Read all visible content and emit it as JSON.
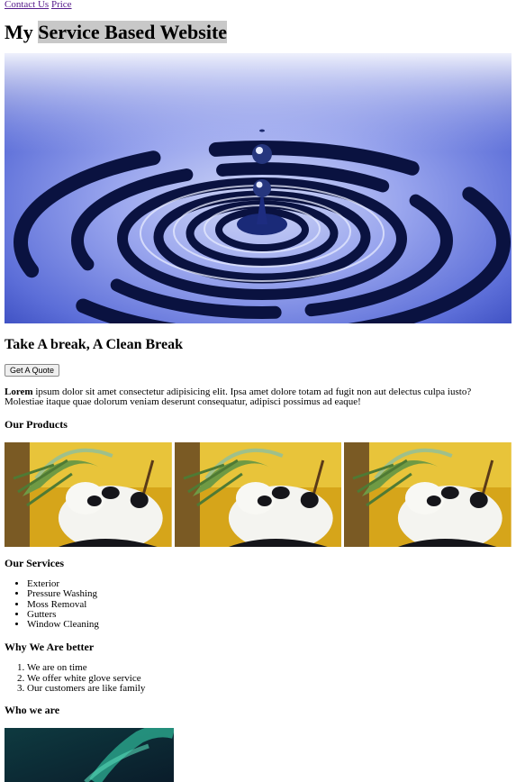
{
  "nav": {
    "contact": "Contact Us",
    "price": "Price"
  },
  "header": {
    "title_plain": "My ",
    "title_highlight": "Service Based Website"
  },
  "hero": {
    "tagline": "Take A break, A Clean Break",
    "cta_label": "Get A Quote"
  },
  "intro": {
    "lead": "Lorem",
    "body": " ipsum dolor sit amet consectetur adipisicing elit. Ipsa amet dolore totam ad fugit non aut delectus culpa iusto? Molestiae itaque quae dolorum veniam deserunt consequatur, adipisci possimus ad eaque!"
  },
  "products": {
    "heading": "Our Products"
  },
  "services": {
    "heading": "Our Services",
    "items": [
      "Exterior",
      "Pressure Washing",
      "Moss Removal",
      "Gutters",
      "Window Cleaning"
    ]
  },
  "better": {
    "heading": "Why We Are better",
    "items": [
      "We are on time",
      "We offer white glove service",
      "Our customers are like family"
    ]
  },
  "who": {
    "heading": "Who we are"
  }
}
